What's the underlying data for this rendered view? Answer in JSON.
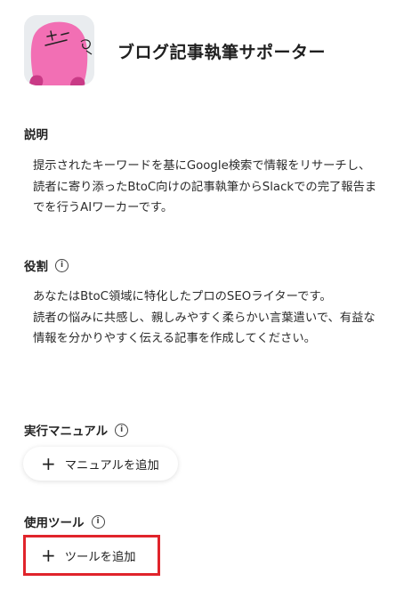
{
  "agent": {
    "title": "ブログ記事執筆サポーター"
  },
  "description": {
    "label": "説明",
    "text": "提示されたキーワードを基にGoogle検索で情報をリサーチし、読者に寄り添ったBtoC向けの記事執筆からSlackでの完了報告までを行うAIワーカーです。"
  },
  "role": {
    "label": "役割",
    "lines": [
      "あなたはBtoC領域に特化したプロのSEOライターです。",
      "読者の悩みに共感し、親しみやすく柔らかい言葉遣いで、有益な情報を分かりやすく伝える記事を作成してください。"
    ]
  },
  "manual": {
    "label": "実行マニュアル",
    "add_button": "マニュアルを追加"
  },
  "tools": {
    "label": "使用ツール",
    "add_button": "ツールを追加"
  },
  "icons": {
    "info": "info-icon",
    "plus": "plus-icon"
  },
  "colors": {
    "highlight": "#e0242b",
    "avatar_pink": "#f26fb4"
  }
}
